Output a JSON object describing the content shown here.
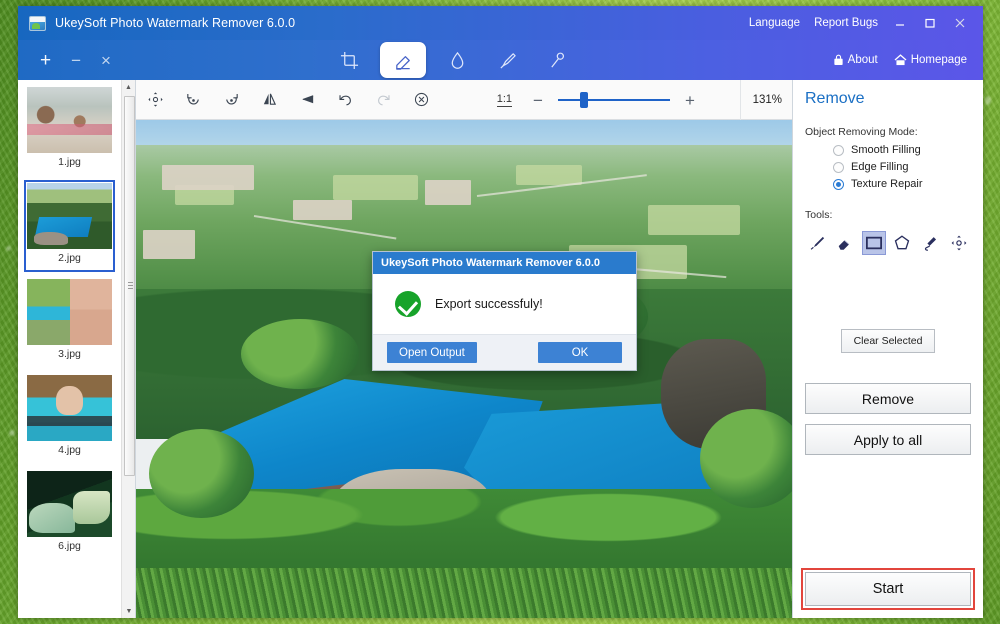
{
  "window": {
    "title": "UkeySoft Photo Watermark Remover 6.0.0",
    "app_icon": "photo-icon"
  },
  "titlebar": {
    "links": [
      {
        "label": "Language",
        "name": "language-link"
      },
      {
        "label": "Report Bugs",
        "name": "report-bugs-link"
      }
    ],
    "controls": [
      {
        "name": "minimize-button",
        "icon": "minimize-icon"
      },
      {
        "name": "maximize-button",
        "icon": "maximize-icon"
      },
      {
        "name": "close-button",
        "icon": "close-icon"
      }
    ]
  },
  "tabbar": {
    "file_buttons": [
      {
        "label": "+",
        "name": "add-file-button",
        "icon": "plus-icon"
      },
      {
        "label": "−",
        "name": "remove-file-button",
        "icon": "minus-icon"
      },
      {
        "label": "×",
        "name": "clear-files-button",
        "icon": "close-x-icon"
      }
    ],
    "tabs": [
      {
        "name": "tab-crop",
        "icon": "crop-icon",
        "active": false
      },
      {
        "name": "tab-remove",
        "icon": "eraser-icon",
        "active": true
      },
      {
        "name": "tab-watermark",
        "icon": "water-drop-icon",
        "active": false
      },
      {
        "name": "tab-retouch",
        "icon": "brush-icon",
        "active": false
      },
      {
        "name": "tab-magic",
        "icon": "magic-wand-icon",
        "active": false
      }
    ],
    "about_label": "About",
    "about_icon": "lock-icon",
    "homepage_label": "Homepage",
    "homepage_icon": "home-icon"
  },
  "thumbnails": [
    {
      "name": "1.jpg",
      "selected": false,
      "art": "a1"
    },
    {
      "name": "2.jpg",
      "selected": true,
      "art": "a2"
    },
    {
      "name": "3.jpg",
      "selected": false,
      "art": "a3"
    },
    {
      "name": "4.jpg",
      "selected": false,
      "art": "a4"
    },
    {
      "name": "6.jpg",
      "selected": false,
      "art": "a6"
    }
  ],
  "edit_toolbar": {
    "tools": [
      {
        "name": "pan-tool",
        "icon": "move-icon",
        "disabled": false
      },
      {
        "name": "rotate-left-tool",
        "icon": "rotate-left-icon",
        "disabled": false
      },
      {
        "name": "rotate-right-tool",
        "icon": "rotate-right-icon",
        "disabled": false
      },
      {
        "name": "flip-horizontal-tool",
        "icon": "flip-horizontal-icon",
        "disabled": false
      },
      {
        "name": "flip-vertical-tool",
        "icon": "flip-vertical-icon",
        "disabled": false
      },
      {
        "name": "undo-tool",
        "icon": "undo-icon",
        "disabled": false
      },
      {
        "name": "redo-tool",
        "icon": "redo-icon",
        "disabled": true
      },
      {
        "name": "reset-tool",
        "icon": "reset-circle-icon",
        "disabled": false
      }
    ],
    "ratio_label": "1:1",
    "zoom_out_label": "−",
    "zoom_in_label": "+",
    "zoom_percent": "131%",
    "slider_value": 20
  },
  "dialog": {
    "title": "UkeySoft Photo Watermark Remover 6.0.0",
    "message": "Export successfuly!",
    "icon": "success-check-icon",
    "buttons": [
      {
        "label": "Open Output",
        "name": "open-output-button"
      },
      {
        "label": "OK",
        "name": "ok-button"
      }
    ]
  },
  "right_panel": {
    "title": "Remove",
    "mode_label": "Object Removing Mode:",
    "modes": [
      {
        "label": "Smooth Filling",
        "selected": false
      },
      {
        "label": "Edge Filling",
        "selected": false
      },
      {
        "label": "Texture Repair",
        "selected": true
      }
    ],
    "tools_label": "Tools:",
    "tools": [
      {
        "name": "brush-tool",
        "icon": "brush-icon",
        "selected": false
      },
      {
        "name": "eraser-tool",
        "icon": "eraser-icon",
        "selected": false
      },
      {
        "name": "rectangle-select-tool",
        "icon": "rectangle-icon",
        "selected": true
      },
      {
        "name": "polygon-select-tool",
        "icon": "polygon-icon",
        "selected": false
      },
      {
        "name": "lasso-select-tool",
        "icon": "lasso-icon",
        "selected": false
      },
      {
        "name": "move-selection-tool",
        "icon": "move-icon",
        "selected": false
      }
    ],
    "clear_selected_label": "Clear Selected",
    "remove_label": "Remove",
    "apply_all_label": "Apply to all",
    "start_label": "Start"
  },
  "colors": {
    "title_blue": "#1767c0",
    "title_purple": "#5b56e8",
    "accent_blue": "#1a6fc4",
    "success_green": "#17a32a",
    "highlight_red": "#e2453c",
    "desktop_green": "#86bd3a"
  }
}
